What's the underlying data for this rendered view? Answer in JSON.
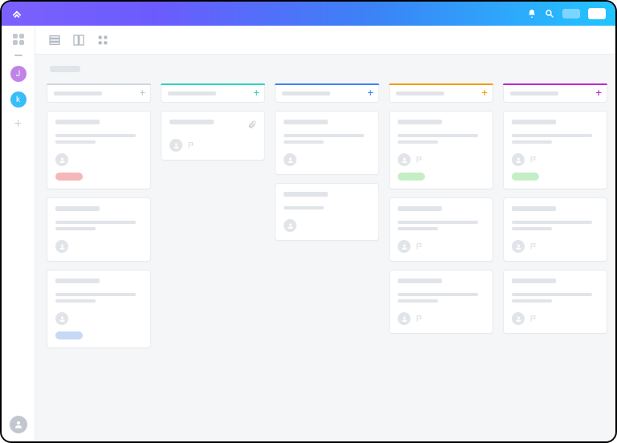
{
  "topbar": {
    "logo_icon": "clickup-logo",
    "notification_icon": "bell-icon",
    "search_icon": "search-icon"
  },
  "sidebar": {
    "avatars": [
      {
        "initial": "J",
        "color": "#c084e8"
      },
      {
        "initial": "k",
        "color": "#38bdf8"
      }
    ]
  },
  "views": {
    "list": "list-view",
    "board": "board-view",
    "grid": "grid-view"
  },
  "board": {
    "columns": [
      {
        "accent": "#d1d5db",
        "plus_color": "#c2c7cf",
        "cards": [
          {
            "title": true,
            "lines": 2,
            "assignee": true,
            "flag": false,
            "tag_color": "#f4b8b8",
            "attach": false
          },
          {
            "title": true,
            "lines": 2,
            "assignee": true,
            "flag": false,
            "tag_color": null,
            "attach": false
          },
          {
            "title": true,
            "lines": 2,
            "assignee": true,
            "flag": false,
            "tag_color": "#c7d9f5",
            "attach": false
          }
        ]
      },
      {
        "accent": "#2dd4bf",
        "plus_color": "#2dd4bf",
        "cards": [
          {
            "title": true,
            "lines": 0,
            "assignee": true,
            "flag": true,
            "tag_color": null,
            "attach": true
          }
        ]
      },
      {
        "accent": "#3b82f6",
        "plus_color": "#3b82f6",
        "cards": [
          {
            "title": true,
            "lines": 2,
            "assignee": true,
            "flag": false,
            "tag_color": null,
            "attach": false
          },
          {
            "title": true,
            "lines": 1,
            "assignee": true,
            "flag": false,
            "tag_color": null,
            "attach": false
          }
        ]
      },
      {
        "accent": "#f59e0b",
        "plus_color": "#f59e0b",
        "cards": [
          {
            "title": true,
            "lines": 2,
            "assignee": true,
            "flag": true,
            "tag_color": "#c6eec6",
            "attach": false
          },
          {
            "title": true,
            "lines": 2,
            "assignee": true,
            "flag": true,
            "tag_color": null,
            "attach": false
          },
          {
            "title": true,
            "lines": 2,
            "assignee": true,
            "flag": true,
            "tag_color": null,
            "attach": false
          }
        ]
      },
      {
        "accent": "#c026d3",
        "plus_color": "#c026d3",
        "cards": [
          {
            "title": true,
            "lines": 2,
            "assignee": true,
            "flag": true,
            "tag_color": "#c6eec6",
            "attach": false
          },
          {
            "title": true,
            "lines": 2,
            "assignee": true,
            "flag": true,
            "tag_color": null,
            "attach": false
          },
          {
            "title": true,
            "lines": 2,
            "assignee": true,
            "flag": true,
            "tag_color": null,
            "attach": false
          }
        ]
      }
    ]
  }
}
